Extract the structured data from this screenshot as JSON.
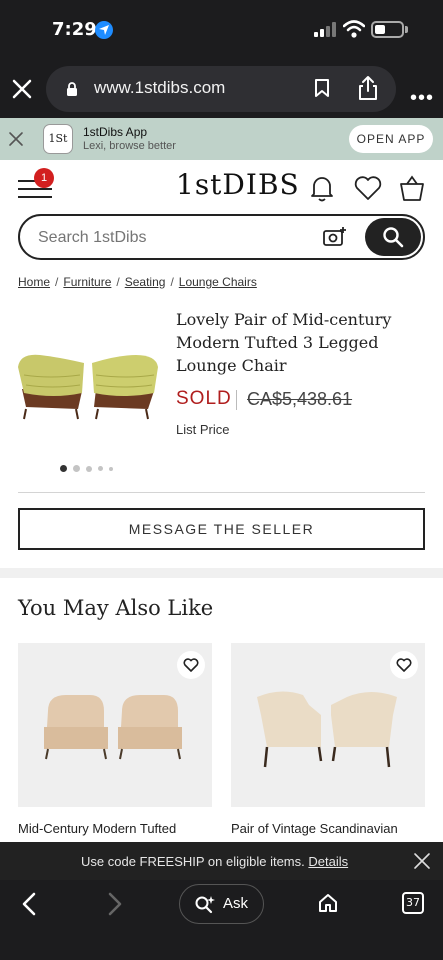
{
  "status_bar": {
    "time": "7:29"
  },
  "browser": {
    "url": "www.1stdibs.com",
    "tab_count": "37",
    "ask_label": "Ask"
  },
  "app_banner": {
    "logo_text": "1St",
    "name": "1stDibs App",
    "subtitle": "Lexi, browse better",
    "open_label": "OPEN APP"
  },
  "header": {
    "logo": "1stDIBS",
    "menu_badge": "1"
  },
  "search": {
    "placeholder": "Search 1stDibs"
  },
  "breadcrumb": {
    "items": [
      "Home",
      "Furniture",
      "Seating",
      "Lounge Chairs"
    ],
    "separator": "/"
  },
  "product": {
    "title": "Lovely Pair of Mid-century Modern Tufted 3 Legged Lounge Chair",
    "status": "SOLD",
    "price": "CA$5,438.61",
    "price_note": "List Price",
    "image_count": 5,
    "current_image": 1
  },
  "message_button": "MESSAGE THE SELLER",
  "recommendations": {
    "title": "You May Also Like",
    "items": [
      {
        "title": "Mid-Century Modern Tufted"
      },
      {
        "title": "Pair of Vintage Scandinavian"
      }
    ]
  },
  "promo": {
    "text": "Use code FREESHIP on eligible items.",
    "link": "Details"
  },
  "colors": {
    "sold_red": "#b01e1e",
    "banner_green": "#bfd2c9",
    "badge_red": "#d21f1f"
  }
}
